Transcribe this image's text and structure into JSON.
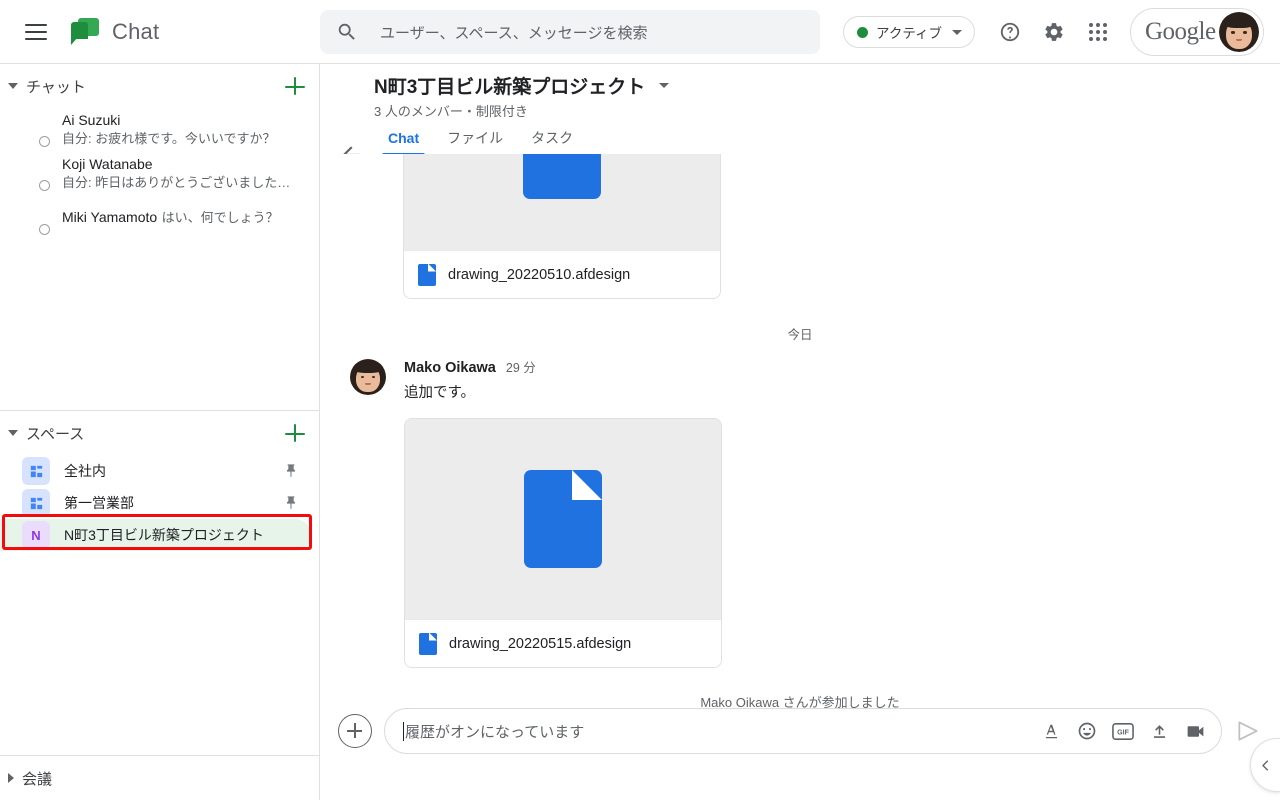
{
  "topbar": {
    "menu_icon": "hamburger-menu-icon",
    "app_name": "Chat",
    "logo_icon": "google-chat-logo",
    "search": {
      "icon": "search-icon",
      "placeholder": "ユーザー、スペース、メッセージを検索"
    },
    "status": {
      "label": "アクティブ",
      "dot_color": "#1e8e3e",
      "caret": "chevron-down-icon"
    },
    "help_icon": "help-icon",
    "settings_icon": "gear-icon",
    "apps_icon": "apps-grid-icon",
    "account": {
      "brand": "Google",
      "avatar": "user-avatar"
    }
  },
  "sidebar": {
    "chat_section": {
      "title": "チャット",
      "expanded": true,
      "add_label": "+",
      "items": [
        {
          "name": "Ai Suzuki",
          "snippet": "自分: お疲れ様です。今いいですか？"
        },
        {
          "name": "Koji Watanabe",
          "snippet": "自分: 昨日はありがとうございました…"
        },
        {
          "name": "Miki Yamamoto",
          "snippet": "はい、何でしょう？"
        }
      ]
    },
    "spaces_section": {
      "title": "スペース",
      "expanded": true,
      "add_label": "+",
      "items": [
        {
          "label": "全社内",
          "icon": "people-icon",
          "pinned": true,
          "selected": false
        },
        {
          "label": "第一営業部",
          "icon": "people-icon",
          "pinned": true,
          "selected": false
        },
        {
          "label": "N町3丁目ビル新築プロジェクト",
          "icon": "letter-icon",
          "initial": "N",
          "pinned": false,
          "selected": true
        }
      ]
    },
    "meetings_section": {
      "title": "会議",
      "expanded": false
    }
  },
  "conversation": {
    "back_icon": "back-arrow-icon",
    "title": "N町3丁目ビル新築プロジェクト",
    "title_caret": "chevron-down-icon",
    "subtitle": "3 人のメンバー・制限付き",
    "tabs": [
      {
        "label": "Chat",
        "active": true
      },
      {
        "label": "ファイル",
        "active": false
      },
      {
        "label": "タスク",
        "active": false
      }
    ],
    "search_icon": "search-icon",
    "collapse_icon": "collapse-icon"
  },
  "messages": {
    "attachment_top": {
      "file_name": "drawing_20220510.afdesign",
      "preview_icon": "document-icon"
    },
    "day_divider": "今日",
    "message": {
      "author": "Mako Oikawa",
      "time": "29 分",
      "text": "追加です。",
      "attachment": {
        "file_name": "drawing_20220515.afdesign",
        "preview_icon": "document-icon"
      }
    },
    "system_message": "Mako Oikawa さんが参加しました"
  },
  "compose": {
    "add_icon": "plus-circle-icon",
    "placeholder": "履歴がオンになっています",
    "icons": [
      {
        "name": "format-text-icon",
        "label": "A"
      },
      {
        "name": "emoji-icon",
        "label": "☺"
      },
      {
        "name": "gif-icon",
        "label": "GIF"
      },
      {
        "name": "upload-icon",
        "label": "↥"
      },
      {
        "name": "video-icon",
        "label": "▭"
      }
    ],
    "send_icon": "send-icon"
  },
  "bottom_tab": {
    "icon": "chevron-left-icon"
  },
  "colors": {
    "accent": "#1a73e8",
    "brand_green": "#1e8e3e",
    "selected_bg": "#e6f4ea",
    "highlight": "#f40b0b"
  }
}
